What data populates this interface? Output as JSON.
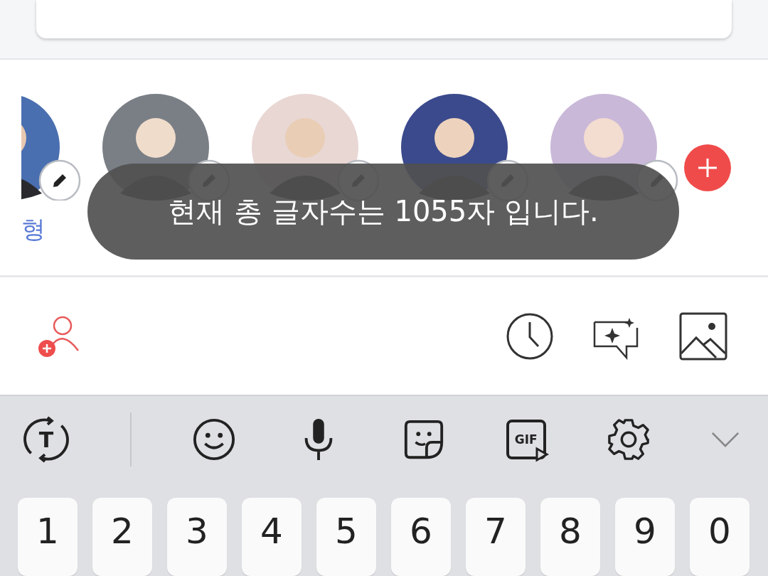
{
  "contacts": [
    {
      "kind": "partial",
      "name": "형"
    },
    {
      "kind": "full"
    },
    {
      "kind": "full"
    },
    {
      "kind": "full"
    },
    {
      "kind": "full"
    }
  ],
  "toast": {
    "text": "현재 총 글자수는 1055자 입니다."
  },
  "keyboard_toolbar": {
    "translate_label": "T",
    "gif_label": "GIF"
  },
  "number_keys": [
    "1",
    "2",
    "3",
    "4",
    "5",
    "6",
    "7",
    "8",
    "9",
    "0"
  ]
}
